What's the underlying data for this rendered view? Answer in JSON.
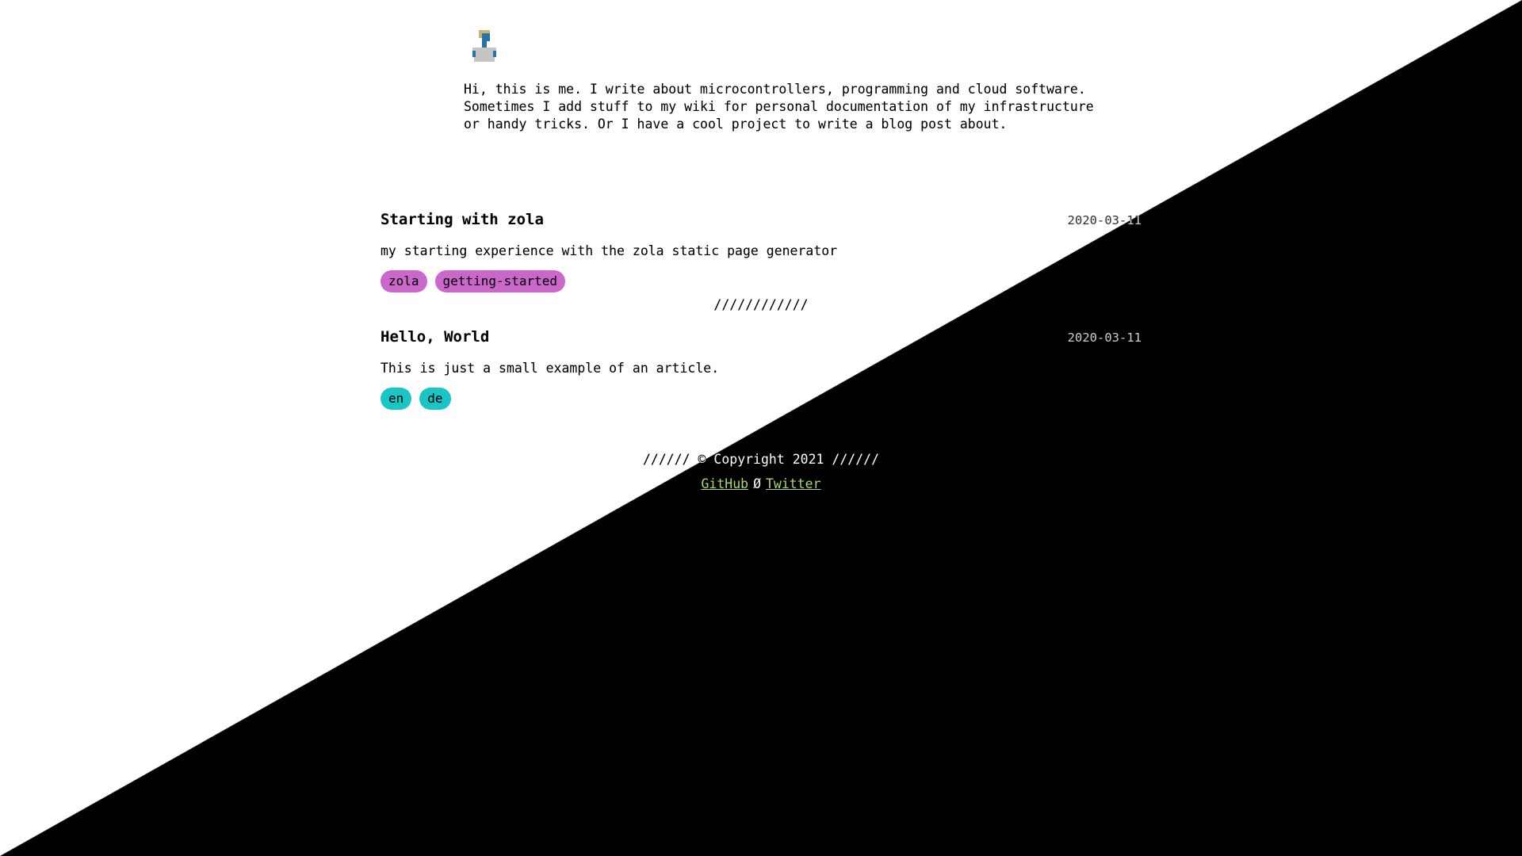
{
  "intro": {
    "avatar_icon": "pixel-person-icon",
    "text": "Hi, this is me. I write about microcontrollers, programming and cloud software.\nSometimes I add stuff to my wiki for personal documentation of my infrastructure\nor handy tricks. Or I have a cool project to write a blog post about."
  },
  "posts": [
    {
      "title": "Starting with zola",
      "date": "2020-03-11",
      "description": "my starting experience with the zola static page generator",
      "tags": [
        "zola",
        "getting-started"
      ],
      "tag_color": "#349834"
    },
    {
      "title": "Hello, World",
      "date": "2020-03-11",
      "description": "This is just a small example of an article.",
      "tags": [
        "en",
        "de"
      ],
      "tag_color": "#e63a3a"
    }
  ],
  "separator": "////////////",
  "footer": {
    "copyright": "////// © Copyright 2021 //////",
    "links": [
      {
        "label": "GitHub"
      },
      {
        "label": "Twitter"
      }
    ],
    "link_separator": "Ø",
    "link_color": "#a6d86f"
  },
  "colors": {
    "background_light": "#ffffff",
    "background_dark": "#000000"
  }
}
